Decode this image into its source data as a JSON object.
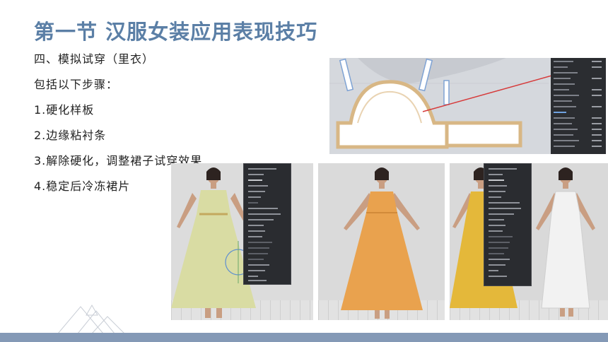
{
  "slide": {
    "title": "第一节   汉服女装应用表现技巧",
    "steps": [
      "四、模拟试穿（里衣）",
      "包括以下步骤：",
      "1.硬化样板",
      "2.边缘粘衬条",
      "3.解除硬化，调整裙子试穿效果",
      "4.稳定后冷冻裙片"
    ]
  },
  "colors": {
    "title": "#5b7fa6",
    "bottom_bar": "#8499b6",
    "panel_dark": "#2b2d31",
    "dress_pale": "#d9dca3",
    "dress_orange": "#e9a24e",
    "dress_yellow": "#e4b83a",
    "dress_white": "#f2f2f2"
  },
  "icons": {
    "deco": "triangle-outline-icon"
  }
}
